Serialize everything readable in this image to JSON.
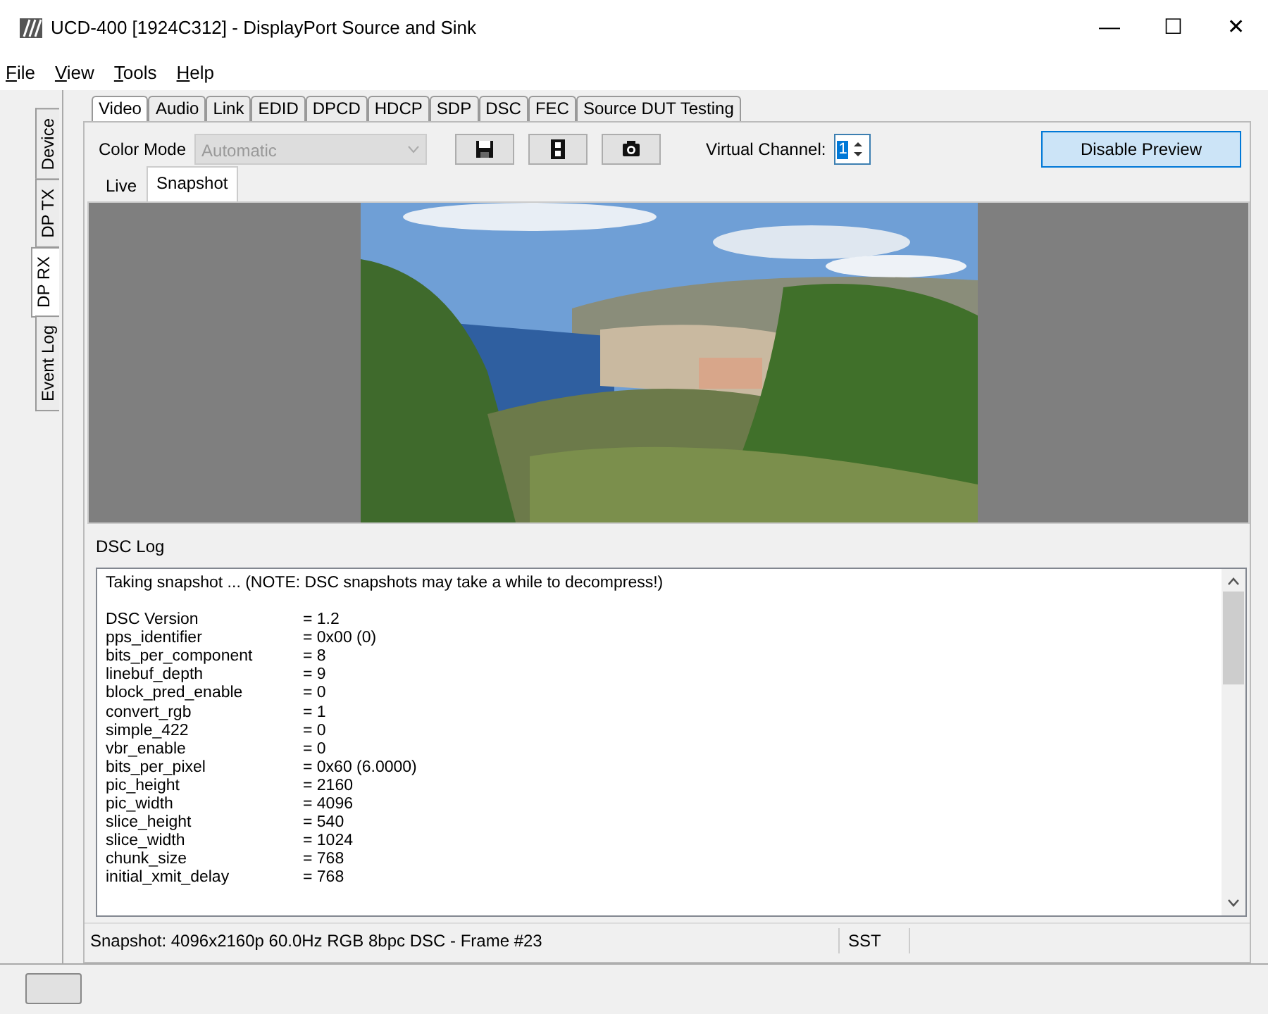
{
  "window": {
    "title": "UCD-400 [1924C312] - DisplayPort Source and Sink",
    "controls": [
      "—",
      "☐",
      "✕"
    ]
  },
  "menu": [
    {
      "label": "File"
    },
    {
      "label": "View"
    },
    {
      "label": "Tools"
    },
    {
      "label": "Help"
    }
  ],
  "side_tabs": [
    {
      "label": "Device",
      "selected": false
    },
    {
      "label": "DP TX",
      "selected": false
    },
    {
      "label": "DP RX",
      "selected": true
    },
    {
      "label": "Event Log",
      "selected": false
    }
  ],
  "tabs": [
    {
      "label": "Video",
      "selected": true
    },
    {
      "label": "Audio",
      "selected": false
    },
    {
      "label": "Link",
      "selected": false
    },
    {
      "label": "EDID",
      "selected": false
    },
    {
      "label": "DPCD",
      "selected": false
    },
    {
      "label": "HDCP",
      "selected": false
    },
    {
      "label": "SDP",
      "selected": false
    },
    {
      "label": "DSC",
      "selected": false
    },
    {
      "label": "FEC",
      "selected": false
    },
    {
      "label": "Source DUT Testing",
      "selected": false
    }
  ],
  "toolbar": {
    "color_mode_label": "Color Mode",
    "color_mode": {
      "value": "Automatic",
      "disabled": true
    },
    "tools": [
      {
        "kind": "save"
      },
      {
        "kind": "film"
      },
      {
        "kind": "camera"
      }
    ],
    "virtual_channel_label": "Virtual Channel:",
    "virtual_channel": "1",
    "preview_button": "Disable Preview"
  },
  "view_tabs": [
    {
      "label": "Live",
      "selected": false
    },
    {
      "label": "Snapshot",
      "selected": true
    }
  ],
  "log": {
    "title": "DSC Log",
    "intro": "Taking snapshot ... (NOTE: DSC snapshots may take a while to decompress!)",
    "entries": [
      {
        "key": "DSC Version",
        "value": "= 1.2"
      },
      {
        "key": "pps_identifier",
        "value": "= 0x00 (0)"
      },
      {
        "key": "bits_per_component",
        "value": "= 8"
      },
      {
        "key": "linebuf_depth",
        "value": "= 9"
      },
      {
        "key": "block_pred_enable",
        "value": "= 0"
      },
      {
        "key": "convert_rgb",
        "value": "= 1"
      },
      {
        "key": "simple_422",
        "value": "= 0"
      },
      {
        "key": "vbr_enable",
        "value": "= 0"
      },
      {
        "key": "bits_per_pixel",
        "value": "= 0x60 (6.0000)"
      },
      {
        "key": "pic_height",
        "value": "= 2160"
      },
      {
        "key": "pic_width",
        "value": "= 4096"
      },
      {
        "key": "slice_height",
        "value": "= 540"
      },
      {
        "key": "slice_width",
        "value": "= 1024"
      },
      {
        "key": "chunk_size",
        "value": "= 768"
      },
      {
        "key": "initial_xmit_delay",
        "value": "= 768"
      }
    ]
  },
  "status_bar": {
    "info": "Snapshot: 4096x2160p 60.0Hz RGB 8bpc DSC  - Frame #23",
    "mode": "SST"
  }
}
